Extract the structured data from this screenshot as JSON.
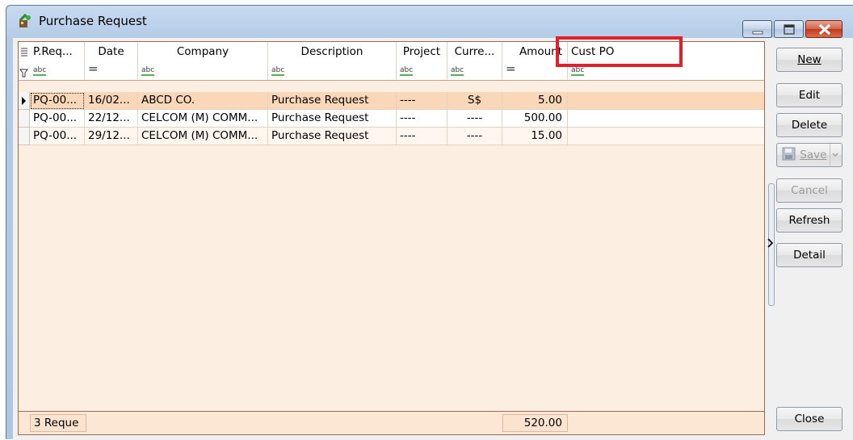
{
  "window": {
    "title": "Purchase Request",
    "icon": "purchase-request-app-icon"
  },
  "grid": {
    "columns": [
      {
        "label": "P.Req...",
        "filter": "abc"
      },
      {
        "label": "Date",
        "filter": "="
      },
      {
        "label": "Company",
        "filter": "abc"
      },
      {
        "label": "Description",
        "filter": "abc"
      },
      {
        "label": "Project",
        "filter": "abc"
      },
      {
        "label": "Curre...",
        "filter": "abc"
      },
      {
        "label": "Amount",
        "filter": "="
      },
      {
        "label": "Cust PO",
        "filter": "abc"
      }
    ],
    "rows": [
      [
        "PQ-00...",
        "16/02...",
        "ABCD CO.",
        "Purchase Request",
        "----",
        "S$",
        "5.00",
        ""
      ],
      [
        "PQ-00...",
        "22/12...",
        "CELCOM (M) COMM...",
        "Purchase Request",
        "----",
        "----",
        "500.00",
        ""
      ],
      [
        "PQ-00...",
        "29/12...",
        "CELCOM (M) COMM...",
        "Purchase Request",
        "----",
        "----",
        "15.00",
        ""
      ]
    ],
    "footer": {
      "count": "3 Reque",
      "total": "520.00"
    }
  },
  "buttons": {
    "new": "New",
    "edit": "Edit",
    "delete": "Delete",
    "save": "Save",
    "cancel": "Cancel",
    "refresh": "Refresh",
    "detail": "Detail",
    "close": "Close"
  },
  "highlight_color": "#e41e2b"
}
